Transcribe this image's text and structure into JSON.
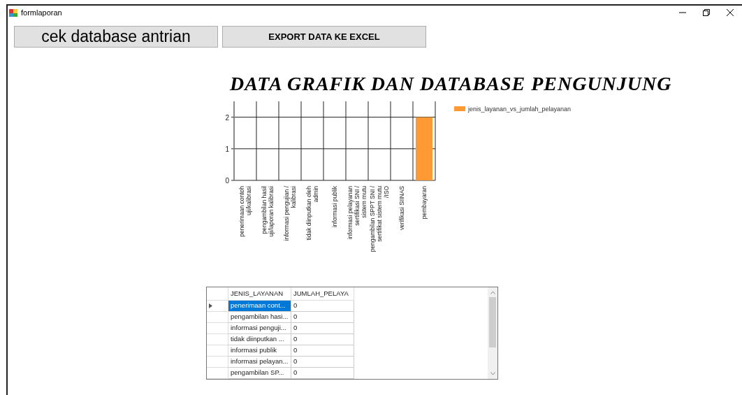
{
  "window": {
    "title": "formlaporan"
  },
  "buttons": [
    {
      "kind": "large",
      "label": "cek database antrian"
    },
    {
      "kind": "normal",
      "label": "EXPORT DATA KE EXCEL"
    }
  ],
  "heading": "DATA GRAFIK DAN DATABASE PENGUNJUNG",
  "chart": {
    "chart_data": {
      "type": "bar",
      "categories": [
        "penerimaan contoh uji/kalibrasi",
        "pengambilan hasil uji/laporan kalibrasi",
        "informasi pengujian / kalibrasi",
        "tidak diinputkan oleh admin",
        "informasi publik",
        "informasi pelayanan sertifikasi SNI / sistem mutu",
        "pengambilan SPPT SNI / sertifikat sistem mutu /ISO",
        "verifikasi SIINAS",
        "pembayaran"
      ],
      "series": [
        {
          "name": "jenis_layanan_vs_jumlah_pelayanan",
          "color": "#ff9933",
          "values": [
            0,
            0,
            0,
            0,
            0,
            0,
            0,
            0,
            2
          ]
        }
      ],
      "ylim": [
        0,
        2.5
      ],
      "yticks": [
        0,
        1,
        2
      ]
    }
  },
  "table": {
    "columns": [
      "JENIS_LAYANAN",
      "JUMLAH_PELAYA"
    ],
    "rows": [
      {
        "cells": [
          "penerimaan cont...",
          "0"
        ],
        "selected": true
      },
      {
        "cells": [
          "pengambilan hasi...",
          "0"
        ],
        "selected": false
      },
      {
        "cells": [
          "informasi penguji...",
          "0"
        ],
        "selected": false
      },
      {
        "cells": [
          "tidak diinputkan ...",
          "0"
        ],
        "selected": false
      },
      {
        "cells": [
          "informasi publik",
          "0"
        ],
        "selected": false
      },
      {
        "cells": [
          "informasi pelayan...",
          "0"
        ],
        "selected": false
      },
      {
        "cells": [
          "pengambilan SP...",
          "0"
        ],
        "selected": false
      }
    ]
  }
}
